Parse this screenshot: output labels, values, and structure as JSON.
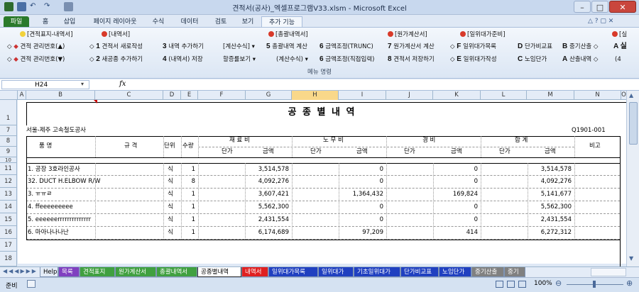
{
  "window": {
    "title": "견적서(공사)_엑셀프로그램V33.xlsm - Microsoft Excel"
  },
  "ribbon_tabs": [
    "파일",
    "홈",
    "삽입",
    "페이지 레이아웃",
    "수식",
    "데이터",
    "검토",
    "보기",
    "추가 기능"
  ],
  "ribbon": {
    "group_caption": "메뉴 명령",
    "headers": [
      "[견적표지-내역서]",
      "[내역서]",
      "[총괄내역서]",
      "[원가계산서]",
      "[일위대가준비]",
      "[실"
    ],
    "row1": {
      "c1": "견적 관리번호(▲)",
      "c2_num": "1",
      "c2": "견적서 새로작성",
      "c3_num": "3",
      "c3": "내역 추가하기",
      "c4": "[계산수식]",
      "c5_num": "5",
      "c5": "총괄내역 계산",
      "c6_num": "6",
      "c6": "금액조정(TRUNC)",
      "c7_num": "7",
      "c7": "원가계산서 계산",
      "c8_num": "F",
      "c8": "일위대가목록",
      "c9_num": "D",
      "c9": "단가비교표",
      "c10_num": "B",
      "c10": "중기산출",
      "c11": "A 실"
    },
    "row2": {
      "c1": "견적 관리번호(▼)",
      "c2_num": "2",
      "c2": "새공종 추가하기",
      "c3_num": "4",
      "c3": "(내역서) 저장",
      "c4": "할증률보기",
      "c5": "(계산수식)",
      "c6_num": "6",
      "c6": "금액조정(직접입력)",
      "c7_num": "8",
      "c7": "견적서 저장하기",
      "c8_num": "E",
      "c8": "일위대가작성",
      "c9_num": "C",
      "c9": "노임단가",
      "c10_num": "A",
      "c10": "산출내역",
      "c11": "(4"
    }
  },
  "formula_bar": {
    "name_box": "H24",
    "fx": "fx",
    "value": ""
  },
  "columns": [
    "A",
    "B",
    "C",
    "D",
    "E",
    "F",
    "G",
    "H",
    "I",
    "J",
    "K",
    "L",
    "M",
    "N",
    "O"
  ],
  "row_numbers": [
    "1",
    "7",
    "8",
    "9",
    "10",
    "11",
    "12",
    "13",
    "14",
    "15",
    "16",
    "17",
    "18"
  ],
  "sheet": {
    "title": "공 종 별 내 역",
    "client": "서울-제주 고속철도공사",
    "doc_no": "Q1901-001",
    "headers": {
      "name": "품          명",
      "spec": "규    격",
      "unit": "단위",
      "qty": "수량",
      "material": "재  료  비",
      "labor": "노  무  비",
      "expense": "경        비",
      "total": "합        계",
      "remark": "비고",
      "unit_price": "단가",
      "amount": "금액"
    },
    "rows": [
      {
        "name": "1. 공장 3호라인공사",
        "unit": "식",
        "qty": "1",
        "mat": "3,514,578",
        "lab": "0",
        "exp": "0",
        "tot": "3,514,578"
      },
      {
        "name": "32. DUCT H.ELBOW R/W",
        "unit": "식",
        "qty": "8",
        "mat": "4,092,276",
        "lab": "0",
        "exp": "0",
        "tot": "4,092,276"
      },
      {
        "name": "3. ㅠㅠㄹ",
        "unit": "식",
        "qty": "1",
        "mat": "3,607,421",
        "lab": "1,364,432",
        "exp": "169,824",
        "tot": "5,141,677"
      },
      {
        "name": "4. ffeeeeeeeee",
        "unit": "식",
        "qty": "1",
        "mat": "5,562,300",
        "lab": "0",
        "exp": "0",
        "tot": "5,562,300"
      },
      {
        "name": "5. eeeeeerrrrrrrrrrrrrr",
        "unit": "식",
        "qty": "1",
        "mat": "2,431,554",
        "lab": "0",
        "exp": "0",
        "tot": "2,431,554"
      },
      {
        "name": "6. 마아나나나난",
        "unit": "식",
        "qty": "1",
        "mat": "6,174,689",
        "lab": "97,209",
        "exp": "414",
        "tot": "6,272,312"
      }
    ]
  },
  "sheet_tabs": [
    "Help",
    "목록",
    "견적표지",
    "원가계산서",
    "총괄내역서",
    "공종별내역",
    "내역서",
    "일위대가목록",
    "일위대가",
    "기초일위대가",
    "단가비교표",
    "노임단가",
    "중기산출",
    "중기"
  ],
  "sheet_tab_colors": [
    "#e4ecf7",
    "#8040c0",
    "#40a040",
    "#40a040",
    "#40a040",
    "#ffffff",
    "#e02020",
    "#2040c0",
    "#2040c0",
    "#2040c0",
    "#2040c0",
    "#2040c0",
    "#808080",
    "#808080"
  ],
  "status": {
    "mode": "준비",
    "zoom": "100%"
  }
}
